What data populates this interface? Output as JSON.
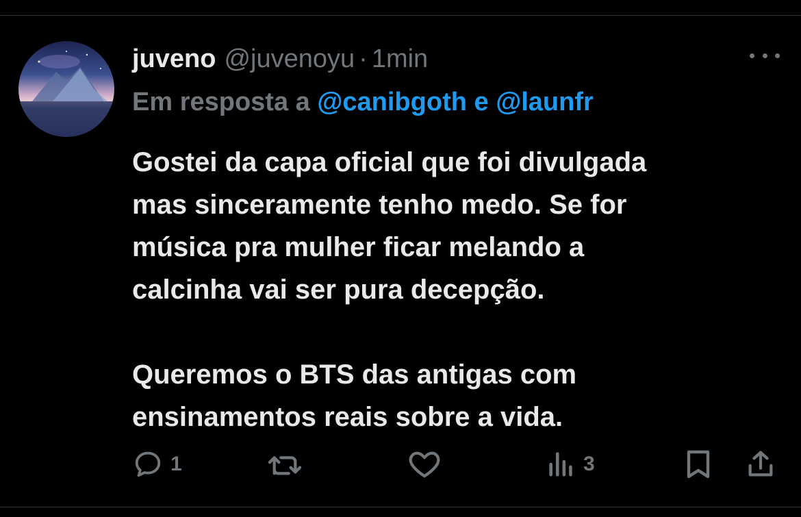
{
  "tweet": {
    "display_name": "juveno",
    "handle": "@juvenoyu",
    "separator": "·",
    "time": "1min",
    "reply_prefix": "Em resposta a ",
    "reply_mention_1": "@canibgoth",
    "reply_joiner": " e ",
    "reply_mention_2": "@launfr",
    "body_line_1": "Gostei da capa oficial que foi divulgada",
    "body_line_2": "mas sinceramente tenho medo. Se for",
    "body_line_3": "música pra mulher ficar melando a",
    "body_line_4": "calcinha vai ser pura decepção.",
    "body_line_5": "Queremos o BTS das antigas com",
    "body_line_6": "ensinamentos reais sobre a vida."
  },
  "actions": {
    "reply_count": "1",
    "retweet_count": "",
    "like_count": "",
    "views_count": "3"
  },
  "icons": {
    "more": "more-horizontal-icon",
    "reply": "reply-bubble-icon",
    "retweet": "retweet-icon",
    "like": "heart-icon",
    "views": "views-chart-icon",
    "bookmark": "bookmark-icon",
    "share": "share-icon"
  },
  "colors": {
    "background": "#000000",
    "text": "#e7e9ea",
    "muted": "#71767b",
    "link": "#1d9bf0"
  }
}
